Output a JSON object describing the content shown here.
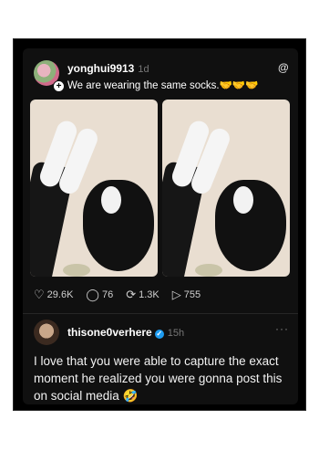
{
  "post": {
    "username": "yonghui9913",
    "time": "1d",
    "caption": "We are wearing the same socks.🤝🤝🤝",
    "follow_badge": "+",
    "platform_icon": "threads-icon",
    "stats": {
      "likes": "29.6K",
      "comments": "76",
      "reposts": "1.3K",
      "shares": "755"
    },
    "icons": {
      "like": "♡",
      "comment": "◯",
      "repost": "⟳",
      "share": "▷"
    }
  },
  "reply": {
    "username": "thisone0verhere",
    "verified": "✓",
    "time": "15h",
    "more": "···",
    "text": "I love that you were able to capture the exact moment he realized you were gonna post this on social media 🤣"
  }
}
